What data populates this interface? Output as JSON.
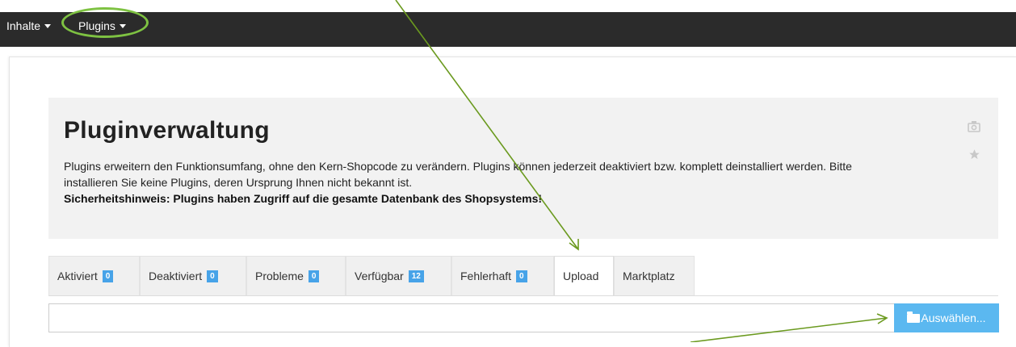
{
  "nav": {
    "items": [
      {
        "label": "Inhalte"
      },
      {
        "label": "Plugins"
      }
    ]
  },
  "header": {
    "title": "Pluginverwaltung",
    "description": "Plugins erweitern den Funktionsumfang, ohne den Kern-Shopcode zu verändern. Plugins können jederzeit deaktiviert bzw. komplett deinstalliert werden. Bitte installieren Sie keine Plugins, deren Ursprung Ihnen nicht bekannt ist.",
    "security_note": "Sicherheitshinweis: Plugins haben Zugriff auf die gesamte Datenbank des Shopsystems!"
  },
  "icons": {
    "camera": "camera-icon",
    "star": "star-icon",
    "folder": "folder-open-icon"
  },
  "tabs": [
    {
      "label": "Aktiviert",
      "count": "0"
    },
    {
      "label": "Deaktiviert",
      "count": "0"
    },
    {
      "label": "Probleme",
      "count": "0"
    },
    {
      "label": "Verfügbar",
      "count": "12"
    },
    {
      "label": "Fehlerhaft",
      "count": "0"
    },
    {
      "label": "Upload",
      "count": null,
      "active": true
    },
    {
      "label": "Marktplatz",
      "count": null
    }
  ],
  "upload": {
    "input_value": "",
    "button_label": "Auswählen..."
  },
  "colors": {
    "topbar": "#2b2b2b",
    "badge": "#47a3e8",
    "button": "#5bb8f0",
    "annotation": "#7ec242",
    "arrow": "#6b9a1f"
  }
}
